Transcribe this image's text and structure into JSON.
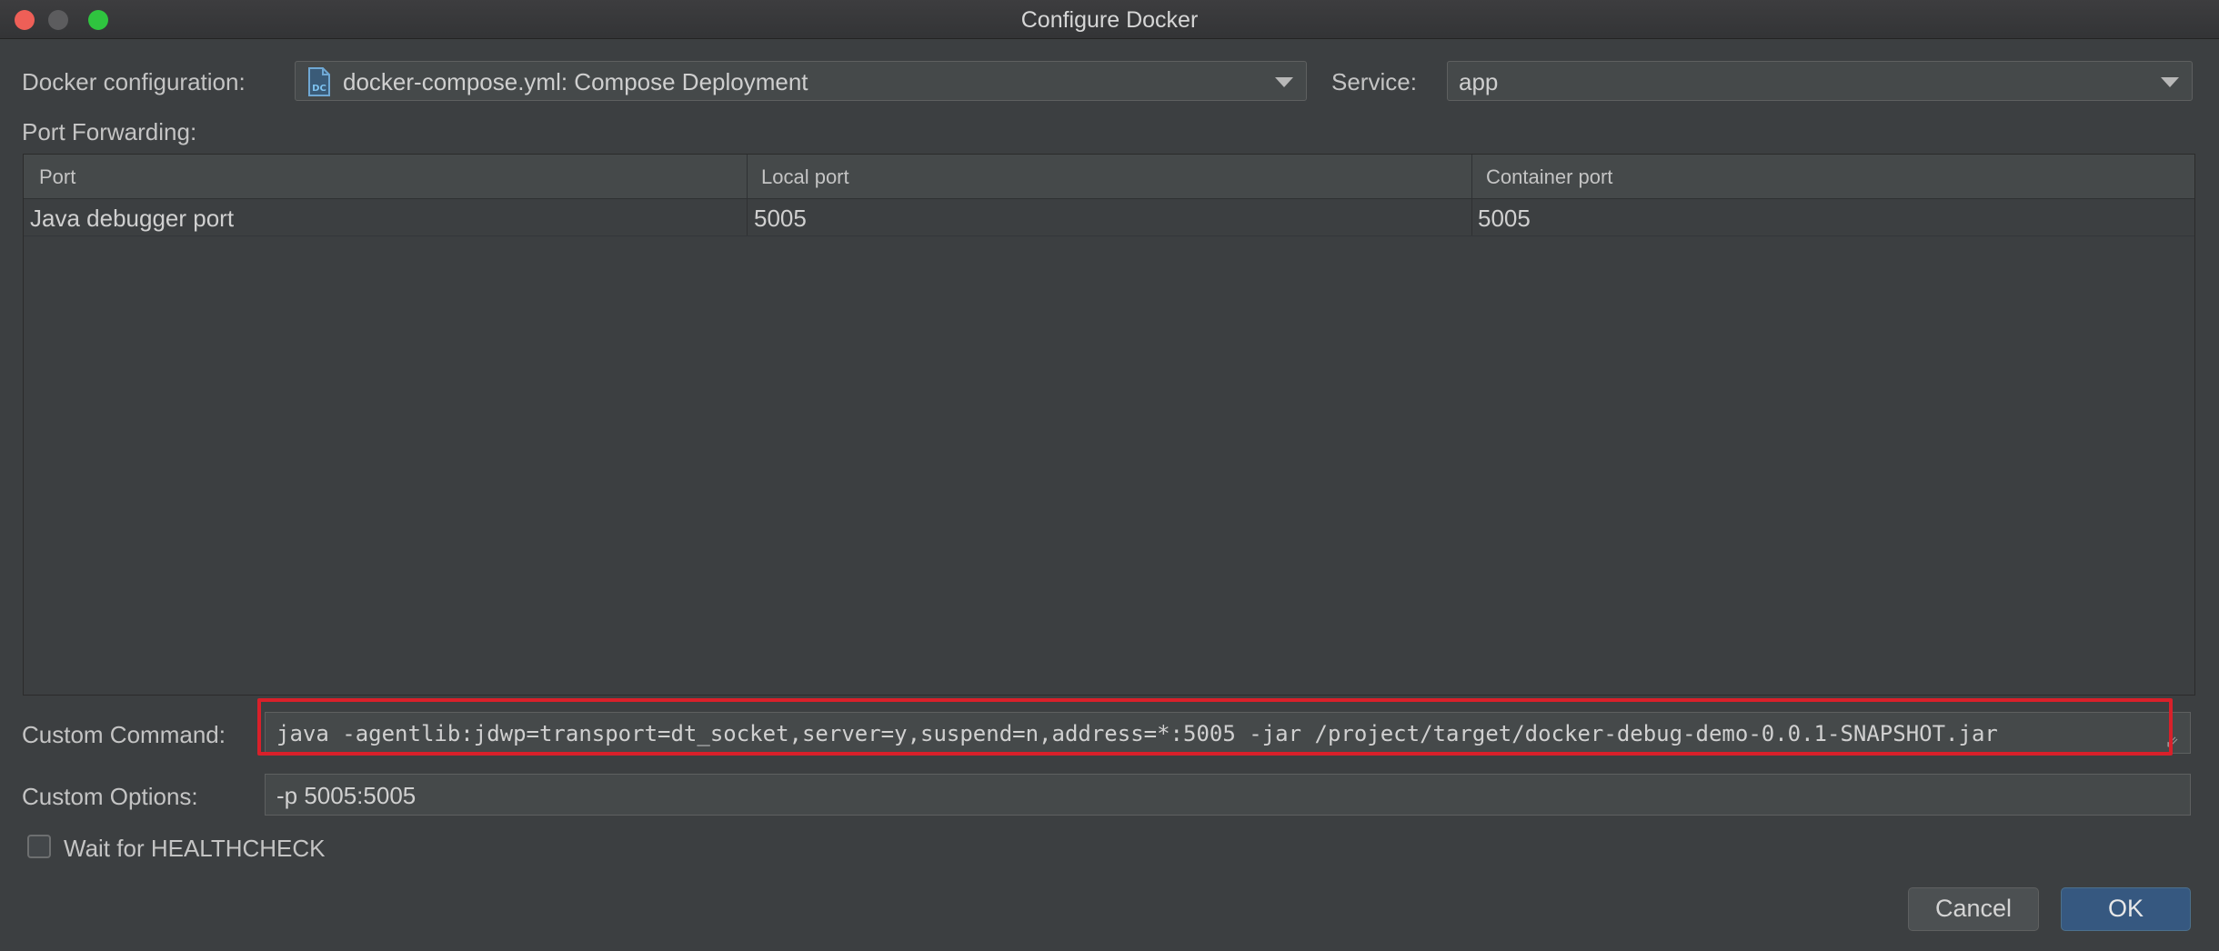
{
  "window": {
    "title": "Configure Docker"
  },
  "docker_configuration": {
    "label": "Docker configuration:",
    "value": "docker-compose.yml: Compose Deployment",
    "icon": "docker-compose-icon",
    "icon_text": "DC"
  },
  "service": {
    "label": "Service:",
    "value": "app"
  },
  "port_forwarding": {
    "label": "Port Forwarding:",
    "columns": [
      "Port",
      "Local port",
      "Container port"
    ],
    "rows": [
      {
        "port": "Java debugger port",
        "local": "5005",
        "container": "5005"
      }
    ]
  },
  "custom_command": {
    "label": "Custom Command:",
    "value": "java -agentlib:jdwp=transport=dt_socket,server=y,suspend=n,address=*:5005 -jar /project/target/docker-debug-demo-0.0.1-SNAPSHOT.jar"
  },
  "custom_options": {
    "label": "Custom Options:",
    "value": "-p 5005:5005"
  },
  "healthcheck": {
    "label": "Wait for HEALTHCHECK",
    "checked": false
  },
  "buttons": {
    "cancel": "Cancel",
    "ok": "OK"
  },
  "colors": {
    "highlight": "#d9202a",
    "ok_button": "#365880",
    "background": "#3c3f41"
  }
}
